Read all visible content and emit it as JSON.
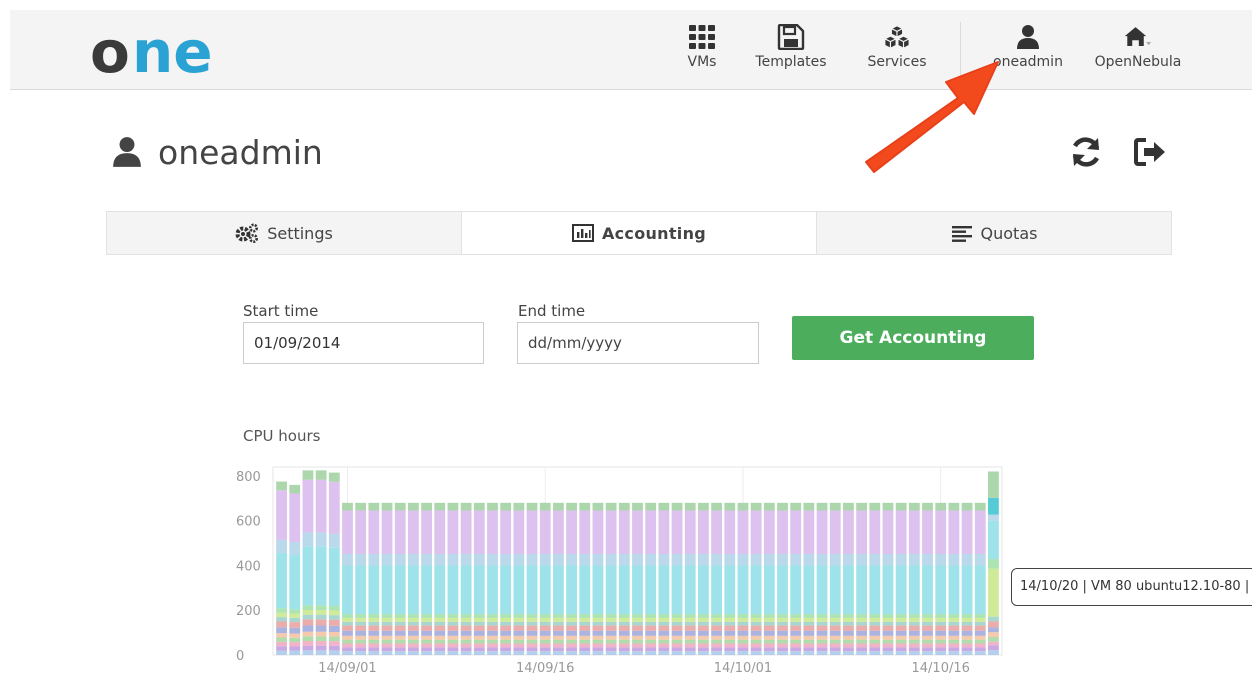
{
  "brand": {
    "logo_text": "one",
    "logo_o_color": "#3a3a3a",
    "logo_ne_color": "#2aa3d4"
  },
  "topnav": {
    "items": [
      {
        "label": "VMs",
        "icon": "grid-icon"
      },
      {
        "label": "Templates",
        "icon": "floppy-icon"
      },
      {
        "label": "Services",
        "icon": "cubes-icon"
      },
      {
        "label": "oneadmin",
        "icon": "user-icon"
      },
      {
        "label": "OpenNebula",
        "icon": "home-icon"
      }
    ]
  },
  "header": {
    "title": "oneadmin",
    "refresh_icon": "refresh-icon",
    "logout_icon": "sign-out-icon"
  },
  "tabs": [
    {
      "label": "Settings",
      "icon": "cogs-icon",
      "active": false
    },
    {
      "label": "Accounting",
      "icon": "bar-chart-icon",
      "active": true
    },
    {
      "label": "Quotas",
      "icon": "align-left-icon",
      "active": false
    }
  ],
  "form": {
    "start_label": "Start time",
    "start_value": "01/09/2014",
    "end_label": "End time",
    "end_placeholder": "dd/mm/yyyy",
    "submit_label": "Get Accounting",
    "submit_color": "#4cae5c"
  },
  "chart_data": {
    "type": "bar",
    "stacked": true,
    "title": "CPU hours",
    "xlabel": "",
    "ylabel": "",
    "ylim": [
      0,
      840
    ],
    "yticks": [
      0,
      200,
      400,
      600,
      800
    ],
    "x_tick_labels": [
      "14/09/01",
      "14/09/16",
      "14/10/01",
      "14/10/16"
    ],
    "x_range": [
      "2014-08-27",
      "2014-10-20"
    ],
    "dates_start": "2014-08-27",
    "grid": true,
    "tooltip": "14/10/20 | VM 80 ubuntu12.10-80 |",
    "series_colors": [
      "#a8c9ea",
      "#c09de0",
      "#f0a8c0",
      "#a6d8a0",
      "#f4c2a0",
      "#9fa8dc",
      "#e8a0a0",
      "#9dd0c8",
      "#c8e88c",
      "#a0e0a8",
      "#8fdfe6",
      "#b0d4e8",
      "#d8b8ec",
      "#a0d0a0"
    ],
    "totals": [
      775,
      760,
      825,
      825,
      815,
      680,
      680,
      680,
      680,
      680,
      680,
      680,
      680,
      680,
      680,
      680,
      680,
      680,
      680,
      680,
      680,
      680,
      680,
      680,
      680,
      680,
      680,
      680,
      680,
      680,
      680,
      680,
      680,
      680,
      680,
      680,
      680,
      680,
      680,
      680,
      680,
      680,
      680,
      680,
      680,
      680,
      680,
      680,
      680,
      680,
      680,
      680,
      680,
      680,
      820
    ],
    "full_stack": [
      15,
      15,
      15,
      15,
      15,
      20,
      20,
      15,
      15,
      15,
      190,
      45,
      170,
      30
    ],
    "full_stack_note_removed": true,
    "last_day_stack": [
      20,
      20,
      15,
      20,
      20,
      20,
      25,
      20,
      200,
      40,
      160,
      25,
      70,
      110
    ]
  }
}
